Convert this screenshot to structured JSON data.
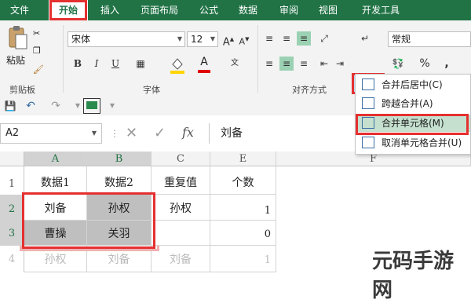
{
  "tabs": [
    "文件",
    "开始",
    "插入",
    "页面布局",
    "公式",
    "数据",
    "审阅",
    "视图",
    "开发工具"
  ],
  "clipboard": {
    "paste_label": "粘贴",
    "group_label": "剪贴板"
  },
  "font": {
    "name": "宋体",
    "size": "12",
    "group_label": "字体",
    "bold": "B",
    "italic": "I",
    "underline": "U",
    "grow": "A",
    "shrink": "A"
  },
  "alignment": {
    "group_label": "对齐方式"
  },
  "number": {
    "format": "常规",
    "percent": "%",
    "comma": ","
  },
  "merge_menu": {
    "items": [
      {
        "label": "合并后居中(C)"
      },
      {
        "label": "跨越合并(A)"
      },
      {
        "label": "合并单元格(M)"
      },
      {
        "label": "取消单元格合并(U)"
      }
    ]
  },
  "formula_bar": {
    "name_box": "A2",
    "fx": "fx",
    "content": "刘备"
  },
  "columns": [
    "A",
    "B",
    "C",
    "E",
    "F"
  ],
  "rows": [
    "1",
    "2",
    "3",
    "4"
  ],
  "cells": {
    "r1": [
      "数据1",
      "数据2",
      "重复值",
      "个数"
    ],
    "r2": [
      "刘备",
      "孙权",
      "孙权",
      "1"
    ],
    "r3": [
      "曹操",
      "关羽",
      "",
      "0"
    ],
    "r4": [
      "孙权",
      "刘备",
      "刘备",
      "1"
    ]
  },
  "watermark": "元码手游网",
  "colors": {
    "ribbon_green": "#217346",
    "highlight_red": "#e53030",
    "selected_gray": "#bfbfbf",
    "active_green": "#9bd1b3"
  }
}
